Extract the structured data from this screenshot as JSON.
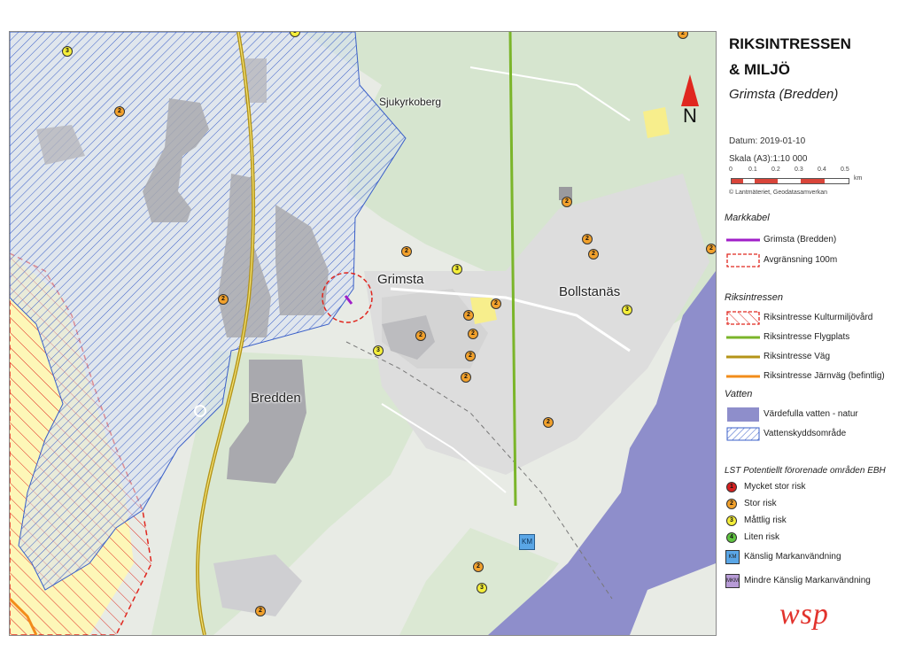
{
  "legend": {
    "title_line1": "RIKSINTRESSEN",
    "title_line2": "& MILJÖ",
    "subtitle": "Grimsta (Bredden)",
    "date": "Datum: 2019-01-10",
    "scale": "Skala (A3):1:10 000",
    "scale_ticks": [
      "0",
      "0.1",
      "0.2",
      "0.3",
      "0.4",
      "0.5"
    ],
    "scale_unit": "km",
    "credit": "© Lantmäteriet, Geodatasamverkan",
    "markkabel": {
      "heading": "Markkabel",
      "items": [
        "Grimsta (Bredden)",
        "Avgränsning 100m"
      ]
    },
    "riksintressen": {
      "heading": "Riksintressen",
      "items": [
        "Riksintresse Kulturmiljövård",
        "Riksintresse Flygplats",
        "Riksintresse Väg",
        "Riksintresse Järnväg (befintlig)"
      ]
    },
    "vatten": {
      "heading": "Vatten",
      "items": [
        "Värdefulla vatten - natur",
        "Vattenskyddsområde"
      ]
    },
    "lst": {
      "heading": "LST Potentiellt förorenade områden EBH",
      "items": [
        {
          "symbol": "1",
          "label": "Mycket stor risk",
          "color": "#d62020"
        },
        {
          "symbol": "2",
          "label": "Stor risk",
          "color": "#f2a12c"
        },
        {
          "symbol": "3",
          "label": "Måttlig risk",
          "color": "#f4ee3a"
        },
        {
          "symbol": "4",
          "label": "Liten risk",
          "color": "#5fc440"
        }
      ],
      "squares": [
        {
          "symbol": "KM",
          "label": "Känslig Markanvändning",
          "color": "#5aa6e6"
        },
        {
          "symbol": "MKM",
          "label": "Mindre Känslig Markanvändning",
          "color": "#b79bd6"
        }
      ]
    },
    "logo": "wsp"
  },
  "map": {
    "north_label": "N",
    "place_labels": [
      "Sjukyrkoberg",
      "Grimsta",
      "Bollstanäs",
      "Bredden"
    ],
    "markers": [
      "3",
      "2",
      "2",
      "3",
      "2",
      "2",
      "2",
      "2",
      "2",
      "3",
      "2",
      "2",
      "2",
      "2",
      "3",
      "2",
      "2",
      "2",
      "3",
      "2",
      "2",
      "3",
      "2"
    ],
    "km_label": "KM"
  },
  "colors": {
    "flygplats": "#7bb52a",
    "vag": "#b49418",
    "jarnvag": "#f28c1a",
    "kulturmiljo": "#e0271f",
    "vatten": "#8e8ecb",
    "vattenskydd": "#3a5fc8",
    "markkabel": "#a01fc8"
  }
}
